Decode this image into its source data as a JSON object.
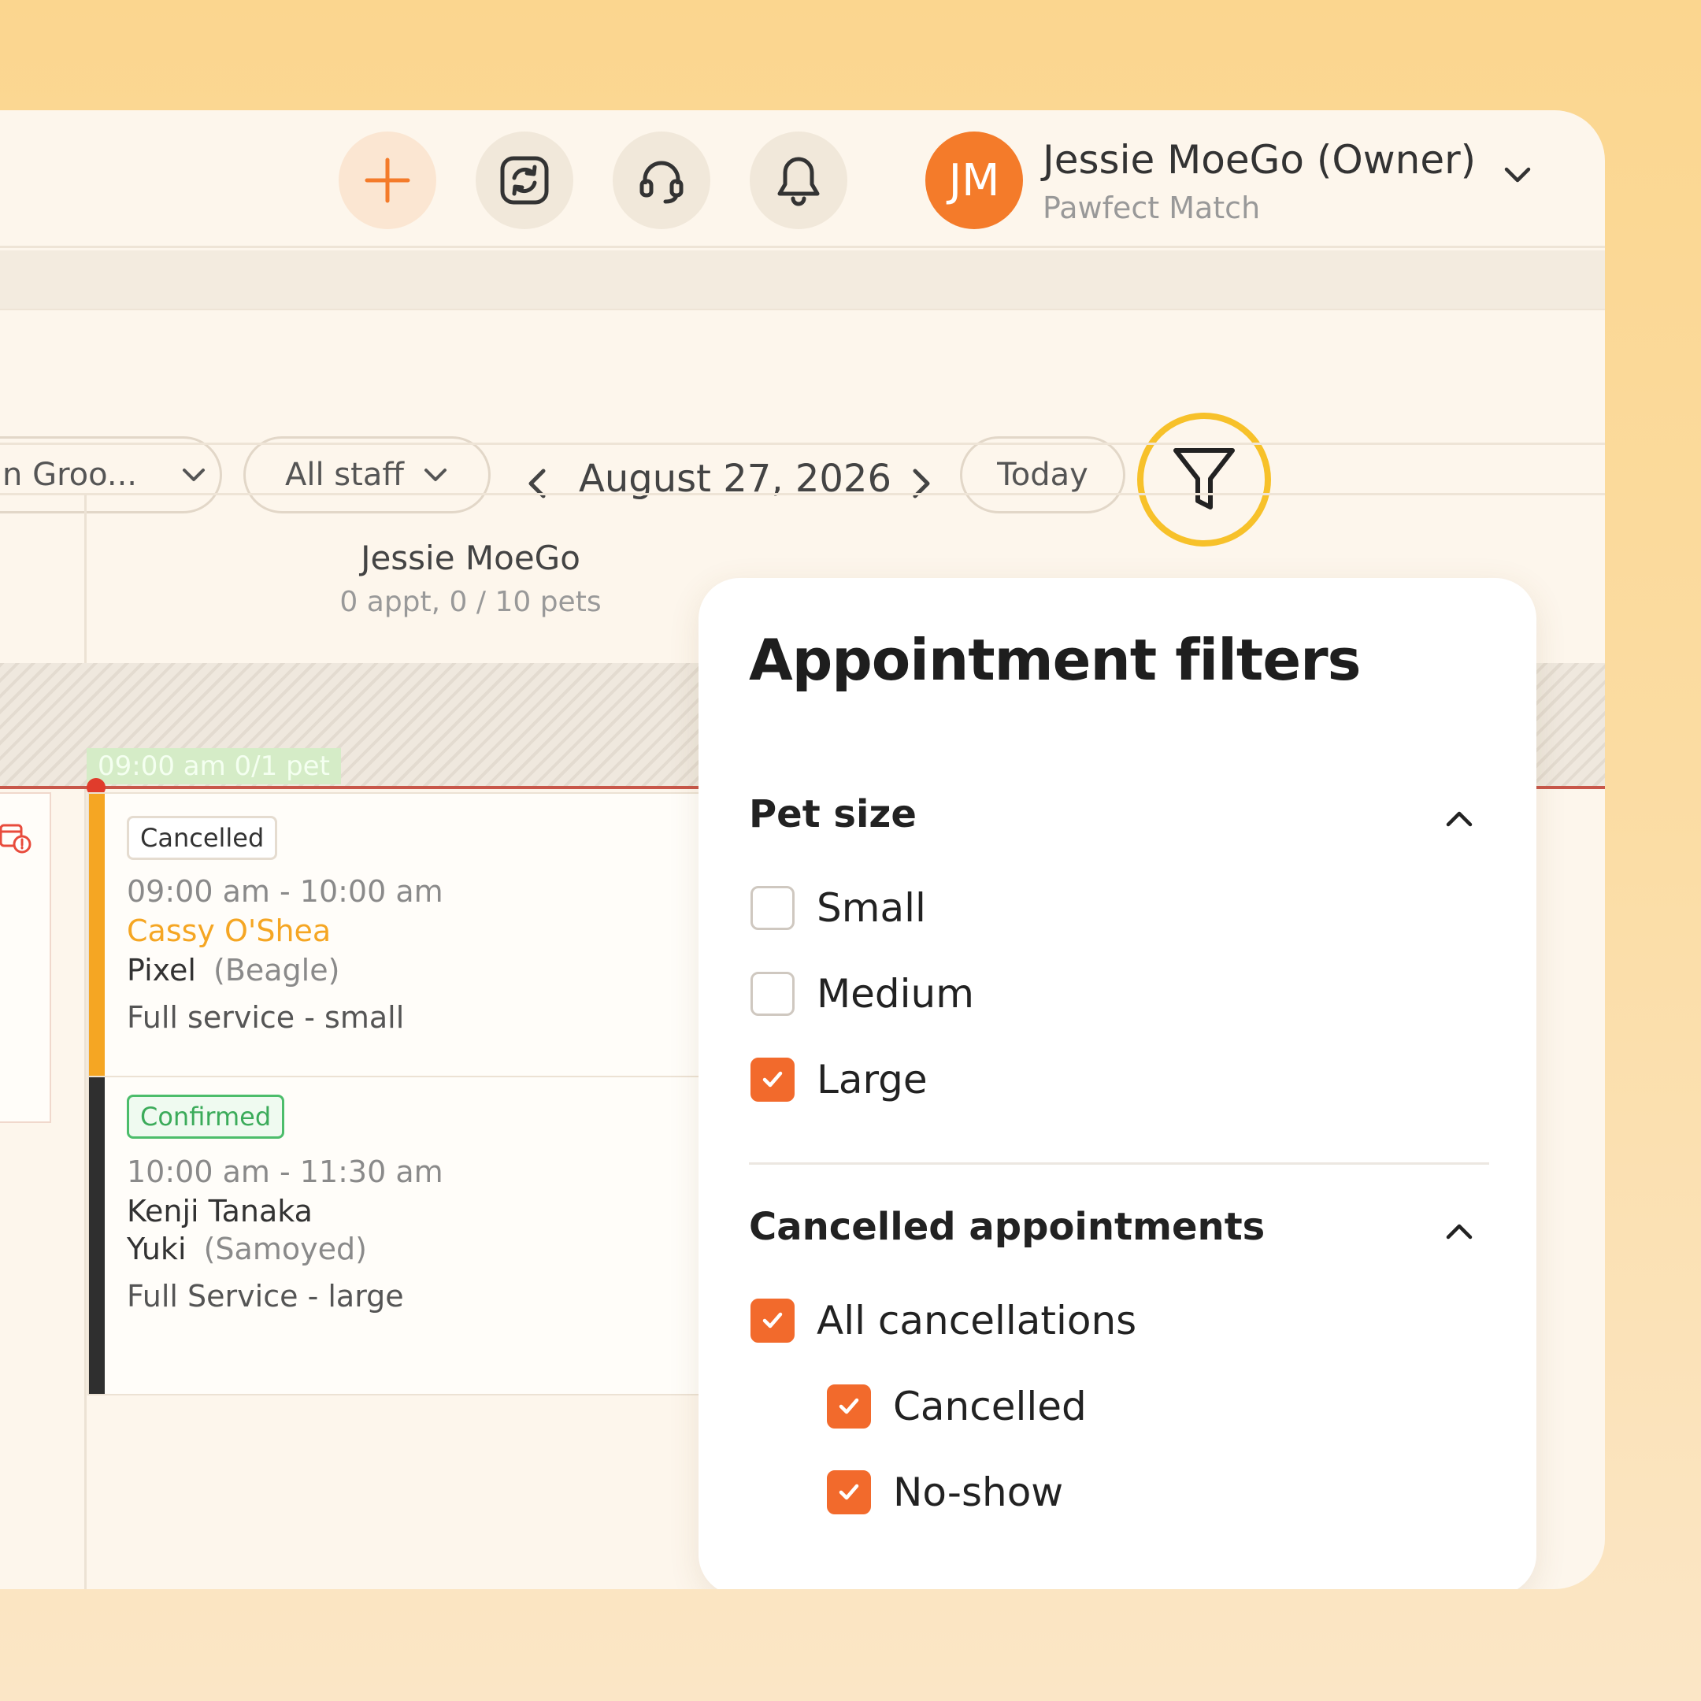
{
  "header": {
    "user_name": "Jessie MoeGo (Owner)",
    "business": "Pawfect Match",
    "avatar_initials": "JM",
    "icons": [
      "plus-icon",
      "sync-icon",
      "headset-icon",
      "bell-icon",
      "chevron-down-icon"
    ]
  },
  "toolbar": {
    "service_filter": "n Groo...",
    "staff_filter": "All staff",
    "date": "August 27, 2026",
    "today_label": "Today"
  },
  "calendar": {
    "staff": {
      "name": "Jessie MoeGo",
      "summary": "0 appt, 0 / 10 pets"
    },
    "time_chip": "09:00 am  0/1 pet",
    "appointments": [
      {
        "status": "Cancelled",
        "time": "09:00 am - 10:00 am",
        "client": "Cassy O'Shea",
        "pet": "Pixel",
        "breed": "(Beagle)",
        "service": "Full service - small",
        "bar_color": "#f5a623"
      },
      {
        "status": "Confirmed",
        "time": "10:00 am - 11:30 am",
        "client": "Kenji Tanaka",
        "pet": "Yuki",
        "breed": "(Samoyed)",
        "service": "Full Service - large",
        "bar_color": "#2f2f2f"
      }
    ]
  },
  "filters": {
    "title": "Appointment filters",
    "pet_size": {
      "title": "Pet size",
      "options": [
        {
          "label": "Small",
          "checked": false
        },
        {
          "label": "Medium",
          "checked": false
        },
        {
          "label": "Large",
          "checked": true
        }
      ]
    },
    "cancelled": {
      "title": "Cancelled appointments",
      "options": [
        {
          "label": "All cancellations",
          "checked": true
        },
        {
          "label": "Cancelled",
          "checked": true
        },
        {
          "label": "No-show",
          "checked": true
        }
      ]
    }
  },
  "colors": {
    "accent": "#f26a2c",
    "highlight": "#f7c12a",
    "client_link": "#f5a623"
  }
}
